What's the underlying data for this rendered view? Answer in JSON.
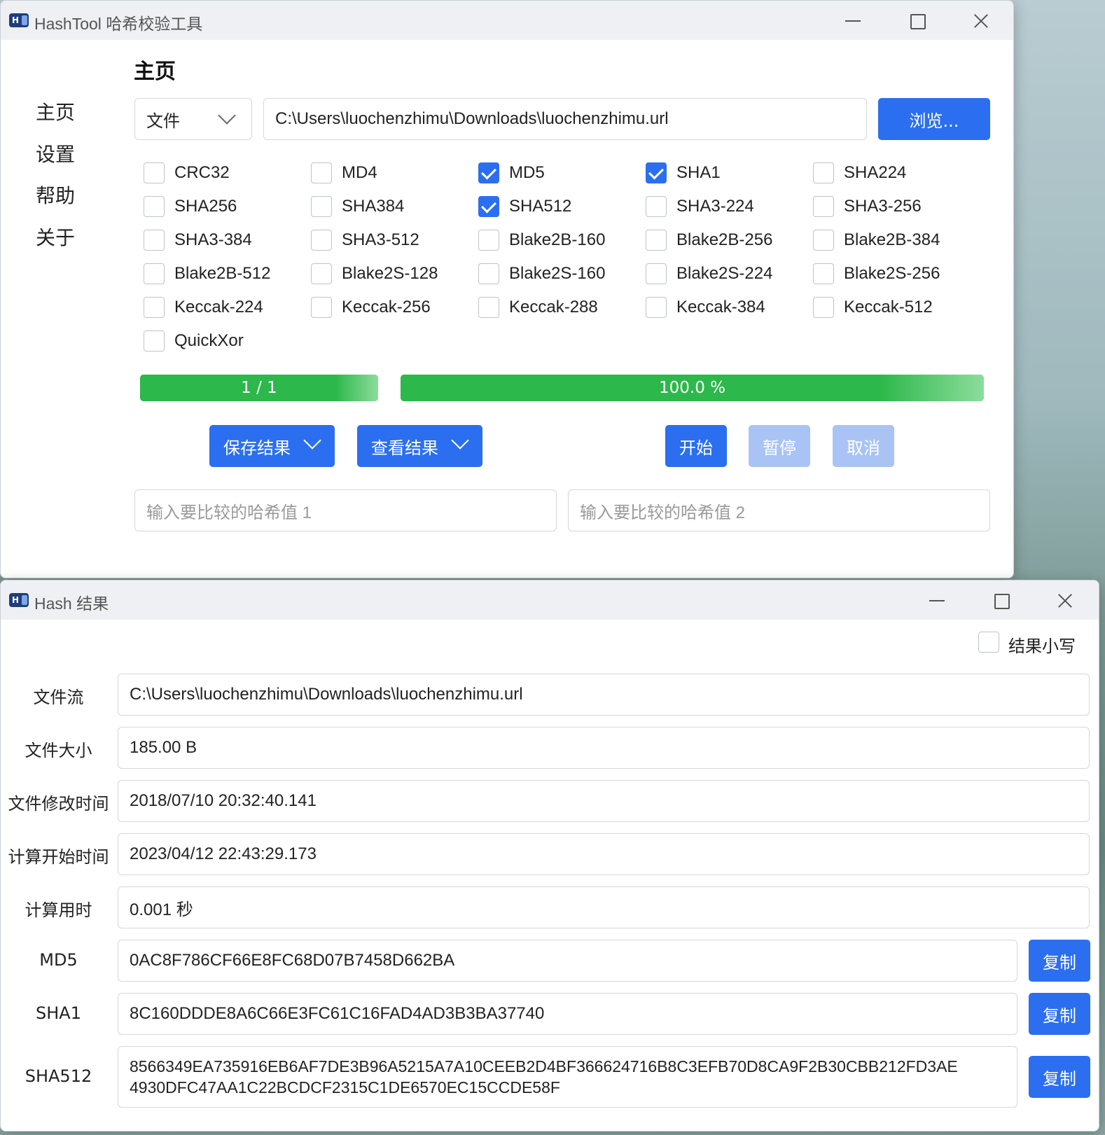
{
  "main_window": {
    "title": "HashTool 哈希校验工具",
    "nav": [
      "主页",
      "设置",
      "帮助",
      "关于"
    ],
    "page_title": "主页",
    "source_type": "文件",
    "path": "C:\\Users\\luochenzhimu\\Downloads\\luochenzhimu.url",
    "browse_label": "浏览...",
    "algorithms": [
      {
        "label": "CRC32",
        "checked": false
      },
      {
        "label": "MD4",
        "checked": false
      },
      {
        "label": "MD5",
        "checked": true
      },
      {
        "label": "SHA1",
        "checked": true
      },
      {
        "label": "SHA224",
        "checked": false
      },
      {
        "label": "SHA256",
        "checked": false
      },
      {
        "label": "SHA384",
        "checked": false
      },
      {
        "label": "SHA512",
        "checked": true
      },
      {
        "label": "SHA3-224",
        "checked": false
      },
      {
        "label": "SHA3-256",
        "checked": false
      },
      {
        "label": "SHA3-384",
        "checked": false
      },
      {
        "label": "SHA3-512",
        "checked": false
      },
      {
        "label": "Blake2B-160",
        "checked": false
      },
      {
        "label": "Blake2B-256",
        "checked": false
      },
      {
        "label": "Blake2B-384",
        "checked": false
      },
      {
        "label": "Blake2B-512",
        "checked": false
      },
      {
        "label": "Blake2S-128",
        "checked": false
      },
      {
        "label": "Blake2S-160",
        "checked": false
      },
      {
        "label": "Blake2S-224",
        "checked": false
      },
      {
        "label": "Blake2S-256",
        "checked": false
      },
      {
        "label": "Keccak-224",
        "checked": false
      },
      {
        "label": "Keccak-256",
        "checked": false
      },
      {
        "label": "Keccak-288",
        "checked": false
      },
      {
        "label": "Keccak-384",
        "checked": false
      },
      {
        "label": "Keccak-512",
        "checked": false
      },
      {
        "label": "QuickXor",
        "checked": false
      }
    ],
    "file_progress_text": "1 / 1",
    "file_progress": 1.0,
    "overall_progress_text": "100.0 %",
    "overall_progress": 1.0,
    "save_results_label": "保存结果",
    "view_results_label": "查看结果",
    "start_label": "开始",
    "pause_label": "暂停",
    "cancel_label": "取消",
    "compare1_placeholder": "输入要比较的哈希值 1",
    "compare2_placeholder": "输入要比较的哈希值 2"
  },
  "result_window": {
    "title": "Hash 结果",
    "lowercase_label": "结果小写",
    "lowercase_checked": false,
    "rows": [
      {
        "label": "文件流",
        "value": "C:\\Users\\luochenzhimu\\Downloads\\luochenzhimu.url"
      },
      {
        "label": "文件大小",
        "value": "185.00 B"
      },
      {
        "label": "文件修改时间",
        "value": "2018/07/10 20:32:40.141"
      },
      {
        "label": "计算开始时间",
        "value": "2023/04/12 22:43:29.173"
      },
      {
        "label": "计算用时",
        "value": "0.001 秒"
      }
    ],
    "hashes": [
      {
        "label": "MD5",
        "value": "0AC8F786CF66E8FC68D07B7458D662BA"
      },
      {
        "label": "SHA1",
        "value": "8C160DDDE8A6C66E3FC61C16FAD4AD3B3BA37740"
      },
      {
        "label": "SHA512",
        "value_line1": "8566349EA735916EB6AF7DE3B96A5215A7A10CEEB2D4BF366624716B8C3EFB70D8CA9F2B30CBB212FD3AE",
        "value_line2": "4930DFC47AA1C22BCDCF2315C1DE6570EC15CCDE58F"
      }
    ],
    "copy_label": "复制"
  }
}
